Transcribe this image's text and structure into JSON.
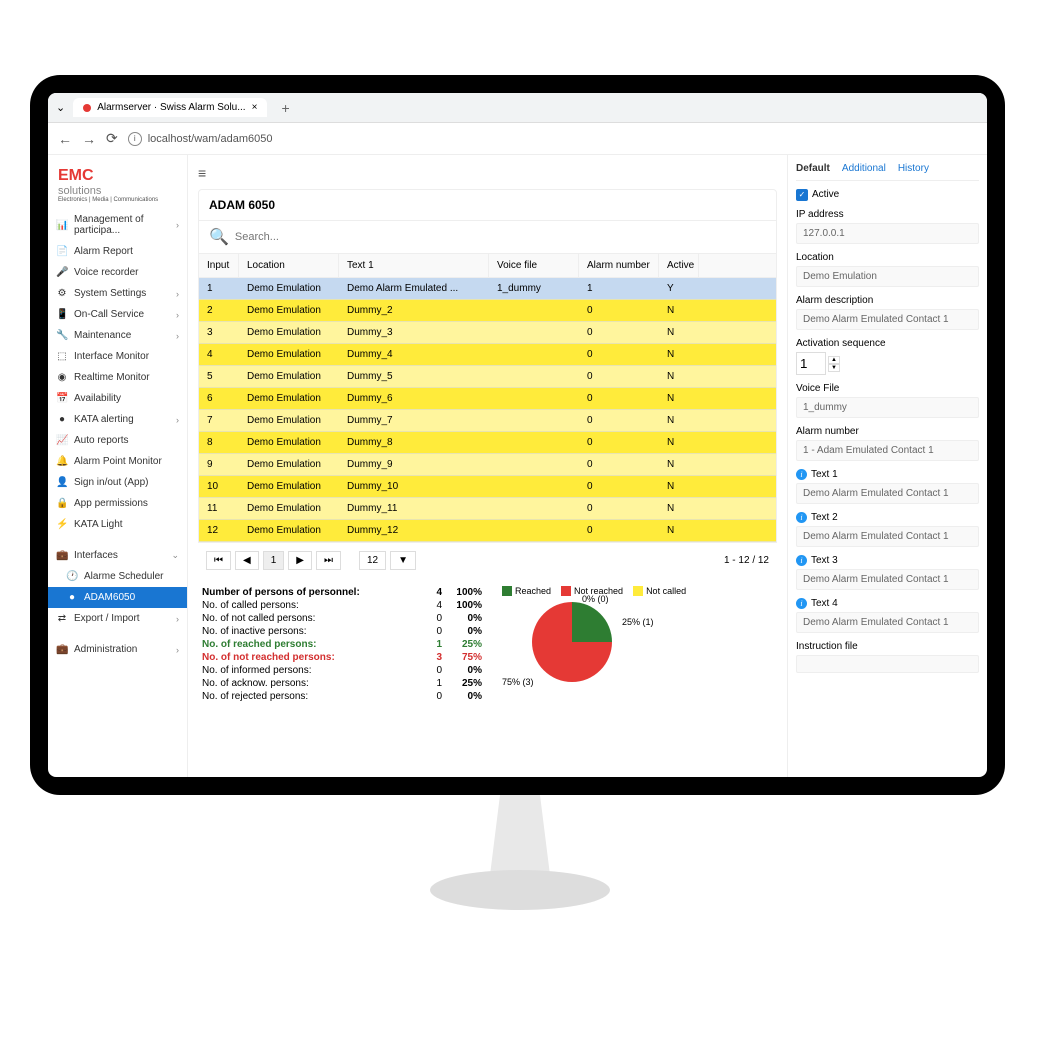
{
  "browser": {
    "tab": "Alarmserver · Swiss Alarm Solu...",
    "url": "localhost/wam/adam6050"
  },
  "logo": {
    "top": "EMC",
    "sub": "solutions",
    "micro": "Electronics | Media | Communications"
  },
  "nav": [
    {
      "ic": "📊",
      "t": "Management of participa...",
      "e": 1
    },
    {
      "ic": "📄",
      "t": "Alarm Report"
    },
    {
      "ic": "🎤",
      "t": "Voice recorder"
    },
    {
      "ic": "⚙",
      "t": "System Settings",
      "e": 1
    },
    {
      "ic": "📱",
      "t": "On-Call Service",
      "e": 1
    },
    {
      "ic": "🔧",
      "t": "Maintenance",
      "e": 1
    },
    {
      "ic": "⬚",
      "t": "Interface Monitor"
    },
    {
      "ic": "◉",
      "t": "Realtime Monitor"
    },
    {
      "ic": "📅",
      "t": "Availability"
    },
    {
      "ic": "●",
      "t": "KATA alerting",
      "e": 1
    },
    {
      "ic": "📈",
      "t": "Auto reports"
    },
    {
      "ic": "🔔",
      "t": "Alarm Point Monitor"
    },
    {
      "ic": "👤",
      "t": "Sign in/out (App)"
    },
    {
      "ic": "🔒",
      "t": "App permissions"
    },
    {
      "ic": "⚡",
      "t": "KATA Light"
    }
  ],
  "nav2": [
    {
      "ic": "💼",
      "t": "Interfaces",
      "e": 1,
      "open": 1
    },
    {
      "ic": "🕐",
      "t": "Alarme Scheduler",
      "sub": 1
    },
    {
      "ic": "●",
      "t": "ADAM6050",
      "sub": 1,
      "active": 1
    },
    {
      "ic": "⇄",
      "t": "Export / Import",
      "e": 1
    }
  ],
  "nav3": [
    {
      "ic": "💼",
      "t": "Administration",
      "e": 1
    }
  ],
  "title": "ADAM 6050",
  "search_ph": "Search...",
  "cols": {
    "input": "Input",
    "location": "Location",
    "text1": "Text 1",
    "voice": "Voice file",
    "alarm": "Alarm number",
    "active": "Active"
  },
  "rows": [
    {
      "i": "1",
      "l": "Demo Emulation",
      "t": "Demo Alarm Emulated ...",
      "v": "1_dummy",
      "a": "1",
      "ac": "Y",
      "sel": 1
    },
    {
      "i": "2",
      "l": "Demo Emulation",
      "t": "Dummy_2",
      "v": "",
      "a": "0",
      "ac": "N",
      "y": 2
    },
    {
      "i": "3",
      "l": "Demo Emulation",
      "t": "Dummy_3",
      "v": "",
      "a": "0",
      "ac": "N",
      "y": 1
    },
    {
      "i": "4",
      "l": "Demo Emulation",
      "t": "Dummy_4",
      "v": "",
      "a": "0",
      "ac": "N",
      "y": 2
    },
    {
      "i": "5",
      "l": "Demo Emulation",
      "t": "Dummy_5",
      "v": "",
      "a": "0",
      "ac": "N",
      "y": 1
    },
    {
      "i": "6",
      "l": "Demo Emulation",
      "t": "Dummy_6",
      "v": "",
      "a": "0",
      "ac": "N",
      "y": 2
    },
    {
      "i": "7",
      "l": "Demo Emulation",
      "t": "Dummy_7",
      "v": "",
      "a": "0",
      "ac": "N",
      "y": 1
    },
    {
      "i": "8",
      "l": "Demo Emulation",
      "t": "Dummy_8",
      "v": "",
      "a": "0",
      "ac": "N",
      "y": 2
    },
    {
      "i": "9",
      "l": "Demo Emulation",
      "t": "Dummy_9",
      "v": "",
      "a": "0",
      "ac": "N",
      "y": 1
    },
    {
      "i": "10",
      "l": "Demo Emulation",
      "t": "Dummy_10",
      "v": "",
      "a": "0",
      "ac": "N",
      "y": 2
    },
    {
      "i": "11",
      "l": "Demo Emulation",
      "t": "Dummy_11",
      "v": "",
      "a": "0",
      "ac": "N",
      "y": 1
    },
    {
      "i": "12",
      "l": "Demo Emulation",
      "t": "Dummy_12",
      "v": "",
      "a": "0",
      "ac": "N",
      "y": 2
    }
  ],
  "pager": {
    "cur": "1",
    "size": "12",
    "info": "1 - 12 / 12"
  },
  "stats": [
    {
      "lbl": "Number of persons of personnel:",
      "n": "4",
      "p": "100%",
      "b": 1
    },
    {
      "lbl": "No. of called persons:",
      "n": "4",
      "p": "100%"
    },
    {
      "lbl": "No. of not called persons:",
      "n": "0",
      "p": "0%"
    },
    {
      "lbl": "No. of inactive persons:",
      "n": "0",
      "p": "0%"
    },
    {
      "lbl": "No. of reached persons:",
      "n": "1",
      "p": "25%",
      "c": "green",
      "b": 1
    },
    {
      "lbl": "No. of not reached persons:",
      "n": "3",
      "p": "75%",
      "c": "red",
      "b": 1
    },
    {
      "lbl": "No. of informed persons:",
      "n": "0",
      "p": "0%"
    },
    {
      "lbl": "No. of acknow. persons:",
      "n": "1",
      "p": "25%"
    },
    {
      "lbl": "No. of rejected persons:",
      "n": "0",
      "p": "0%"
    }
  ],
  "chart_data": {
    "type": "pie",
    "title": "",
    "series": [
      {
        "name": "Reached",
        "value": 25,
        "color": "#2e7d32"
      },
      {
        "name": "Not reached",
        "value": 75,
        "color": "#e53935"
      },
      {
        "name": "Not called",
        "value": 0,
        "color": "#ffeb3b"
      }
    ],
    "labels": [
      "0% (0)",
      "25% (1)",
      "75% (3)"
    ]
  },
  "legend": {
    "reached": "Reached",
    "notreached": "Not reached",
    "notcalled": "Not called"
  },
  "tabs": {
    "default": "Default",
    "additional": "Additional",
    "history": "History"
  },
  "form": {
    "active": "Active",
    "ip_l": "IP address",
    "ip_v": "127.0.0.1",
    "loc_l": "Location",
    "loc_v": "Demo Emulation",
    "desc_l": "Alarm description",
    "desc_v": "Demo Alarm Emulated Contact 1",
    "seq_l": "Activation sequence",
    "seq_v": "1",
    "vf_l": "Voice File",
    "vf_v": "1_dummy",
    "an_l": "Alarm number",
    "an_v": "1 - Adam Emulated Contact 1",
    "t1_l": "Text 1",
    "t1_v": "Demo Alarm Emulated Contact 1",
    "t2_l": "Text 2",
    "t2_v": "Demo Alarm Emulated Contact 1",
    "t3_l": "Text 3",
    "t3_v": "Demo Alarm Emulated Contact 1",
    "t4_l": "Text 4",
    "t4_v": "Demo Alarm Emulated Contact 1",
    "if_l": "Instruction file",
    "if_v": ""
  }
}
